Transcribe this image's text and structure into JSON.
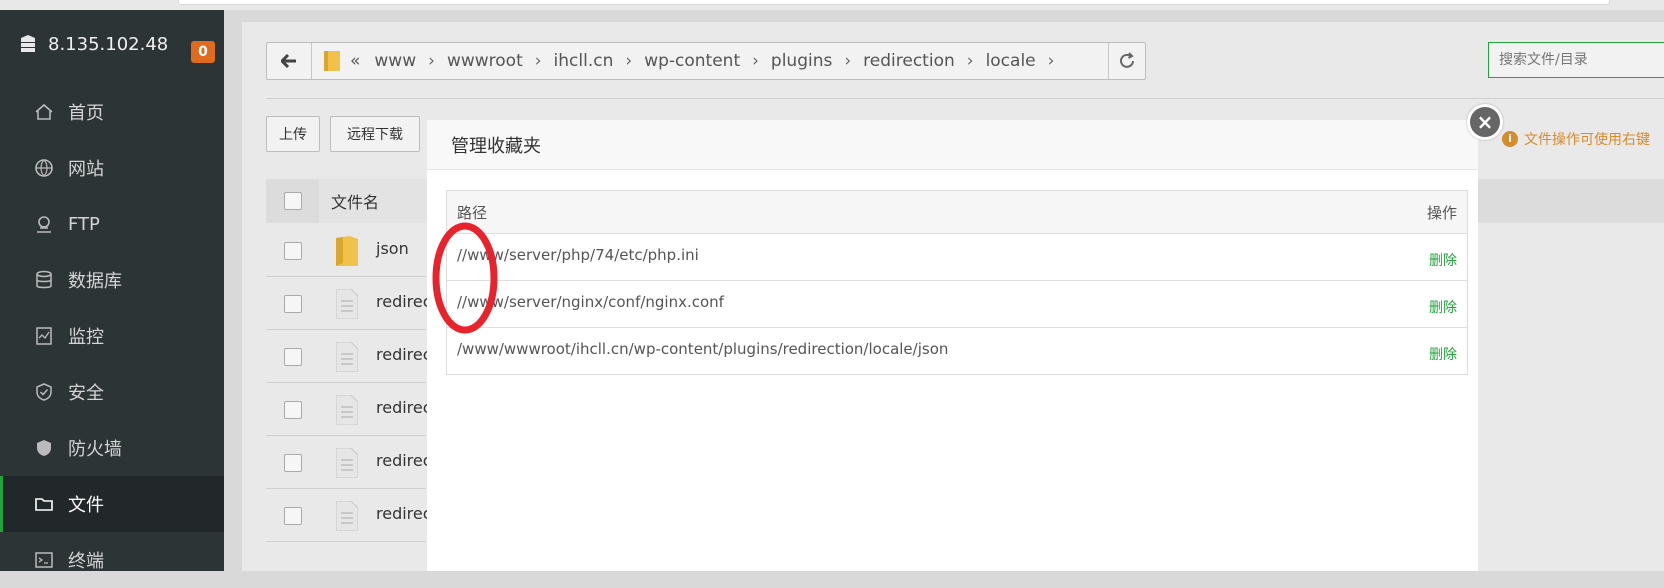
{
  "server": {
    "ip": "8.135.102.48",
    "badge": "0"
  },
  "nav": [
    {
      "label": "首页",
      "icon": "home-icon"
    },
    {
      "label": "网站",
      "icon": "globe-icon"
    },
    {
      "label": "FTP",
      "icon": "ftp-icon"
    },
    {
      "label": "数据库",
      "icon": "database-icon"
    },
    {
      "label": "监控",
      "icon": "monitor-icon"
    },
    {
      "label": "安全",
      "icon": "shield-check-icon"
    },
    {
      "label": "防火墙",
      "icon": "firewall-icon"
    },
    {
      "label": "文件",
      "icon": "folder-icon",
      "active": true
    },
    {
      "label": "终端",
      "icon": "terminal-icon"
    }
  ],
  "breadcrumb": [
    "www",
    "wwwroot",
    "ihcll.cn",
    "wp-content",
    "plugins",
    "redirection",
    "locale"
  ],
  "search": {
    "placeholder": "搜索文件/目录"
  },
  "toolbar": {
    "upload": "上传",
    "remote_download": "远程下载"
  },
  "tip": "文件操作可使用右键",
  "files": {
    "header_name": "文件名",
    "rows": [
      {
        "name": "json",
        "type": "folder"
      },
      {
        "name": "redirect",
        "type": "file"
      },
      {
        "name": "redirect",
        "type": "file"
      },
      {
        "name": "redirect",
        "type": "file"
      },
      {
        "name": "redirect",
        "type": "file"
      },
      {
        "name": "redirect",
        "type": "file"
      }
    ]
  },
  "modal": {
    "title": "管理收藏夹",
    "col_path": "路径",
    "col_op": "操作",
    "rows": [
      {
        "path": "//www/server/php/74/etc/php.ini",
        "action": "删除"
      },
      {
        "path": "//www/server/nginx/conf/nginx.conf",
        "action": "删除"
      },
      {
        "path": "/www/wwwroot/ihcll.cn/wp-content/plugins/redirection/locale/json",
        "action": "删除"
      }
    ]
  },
  "colors": {
    "accent": "#20a53a",
    "sidebar": "#2d3436",
    "badge": "#e06a1e",
    "annotation": "#e8232c"
  }
}
